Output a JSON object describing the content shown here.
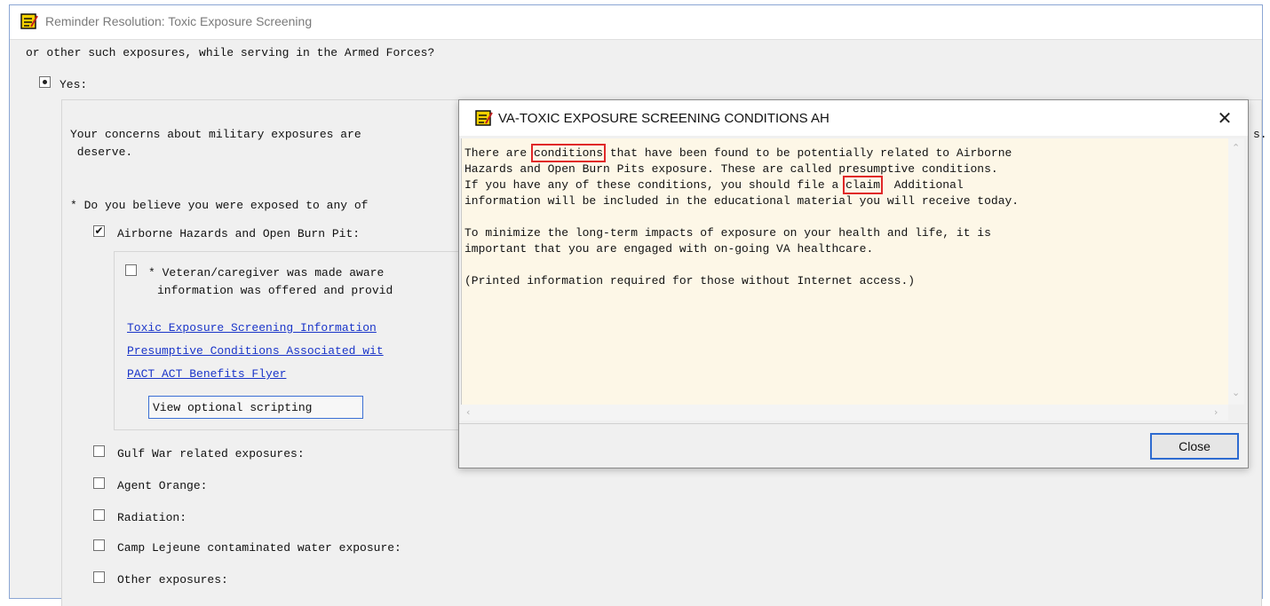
{
  "main_window": {
    "title": "Reminder Resolution: Toxic Exposure Screening",
    "question_tail": "or other such exposures, while serving in the Armed Forces?",
    "yes_label": "Yes:",
    "concern_line1": "Your concerns about military exposures are",
    "concern_line2": " deserve.",
    "right_clip_text": "s.",
    "believe_question": "* Do you believe you were exposed to any of",
    "airborne_label": "Airborne Hazards and Open Burn Pit:",
    "veteran_line1": "* Veteran/caregiver was made aware",
    "veteran_line2": "information was offered and provid",
    "links": [
      "Toxic Exposure Screening Information",
      "Presumptive Conditions Associated wit",
      "PACT ACT Benefits Flyer"
    ],
    "optional_button": "View optional scripting",
    "exposures": [
      "Gulf War related exposures:",
      "Agent Orange:",
      "Radiation:",
      "Camp Lejeune contaminated water exposure:",
      "Other exposures:"
    ]
  },
  "dialog": {
    "title": "VA-TOXIC EXPOSURE SCREENING CONDITIONS AH",
    "line1_pre": "There are ",
    "line1_hl": "conditions",
    "line1_post": " that have been found to be potentially related to Airborne",
    "line2": "Hazards and Open Burn Pits exposure. These are called presumptive conditions.",
    "line3_pre": "If you have any of these conditions, you should file a ",
    "line3_hl": "claim",
    "line3_post": "  Additional",
    "line4": "information will be included in the educational material you will receive today.",
    "line5": "To minimize the long-term impacts of exposure on your health and life, it is",
    "line6": "important that you are engaged with on-going VA healthcare.",
    "line7": "(Printed information required for those without Internet access.)",
    "close_label": "Close"
  },
  "icons": {
    "app": "note-pencil-icon",
    "close": "close-x-icon"
  },
  "colors": {
    "highlight": "#e02828",
    "link": "#1a35c9",
    "memo_bg": "#fdf7e7"
  }
}
